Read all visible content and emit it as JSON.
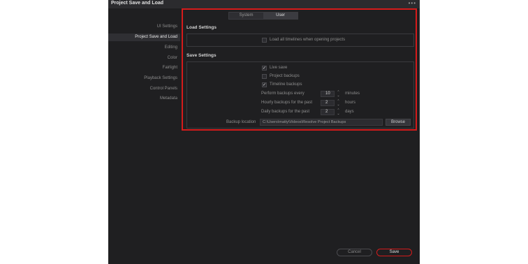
{
  "window": {
    "title": "Project Save and Load",
    "menu_icon": "more-dots-icon"
  },
  "sidebar": {
    "items": [
      {
        "label": "UI Settings"
      },
      {
        "label": "Project Save and Load"
      },
      {
        "label": "Editing"
      },
      {
        "label": "Color"
      },
      {
        "label": "Fairlight"
      },
      {
        "label": "Playback Settings"
      },
      {
        "label": "Control Panels"
      },
      {
        "label": "Metadata"
      }
    ],
    "active_index": 1
  },
  "tabs": [
    {
      "label": "System"
    },
    {
      "label": "User"
    }
  ],
  "active_tab": "User",
  "load_settings": {
    "heading": "Load Settings",
    "load_all_timelines": {
      "label": "Load all timelines when opening projects",
      "checked": false
    }
  },
  "save_settings": {
    "heading": "Save Settings",
    "live_save": {
      "label": "Live save",
      "checked": true
    },
    "project_backups": {
      "label": "Project backups",
      "checked": false
    },
    "timeline_backups": {
      "label": "Timeline backups",
      "checked": true
    },
    "perform_backups": {
      "label": "Perform backups every",
      "value": "10",
      "unit": "minutes"
    },
    "hourly_backups": {
      "label": "Hourly backups for the past",
      "value": "2",
      "unit": "hours"
    },
    "daily_backups": {
      "label": "Daily backups for the past",
      "value": "2",
      "unit": "days"
    },
    "backup_location": {
      "label": "Backup location",
      "value": "C:\\Users\\matty\\Videos\\Resolve Project Backups",
      "browse_label": "Browse"
    }
  },
  "footer": {
    "cancel_label": "Cancel",
    "save_label": "Save"
  },
  "colors": {
    "accent": "#d51b1b",
    "background": "#1f1f21",
    "titlebar": "#2b2b2e"
  }
}
